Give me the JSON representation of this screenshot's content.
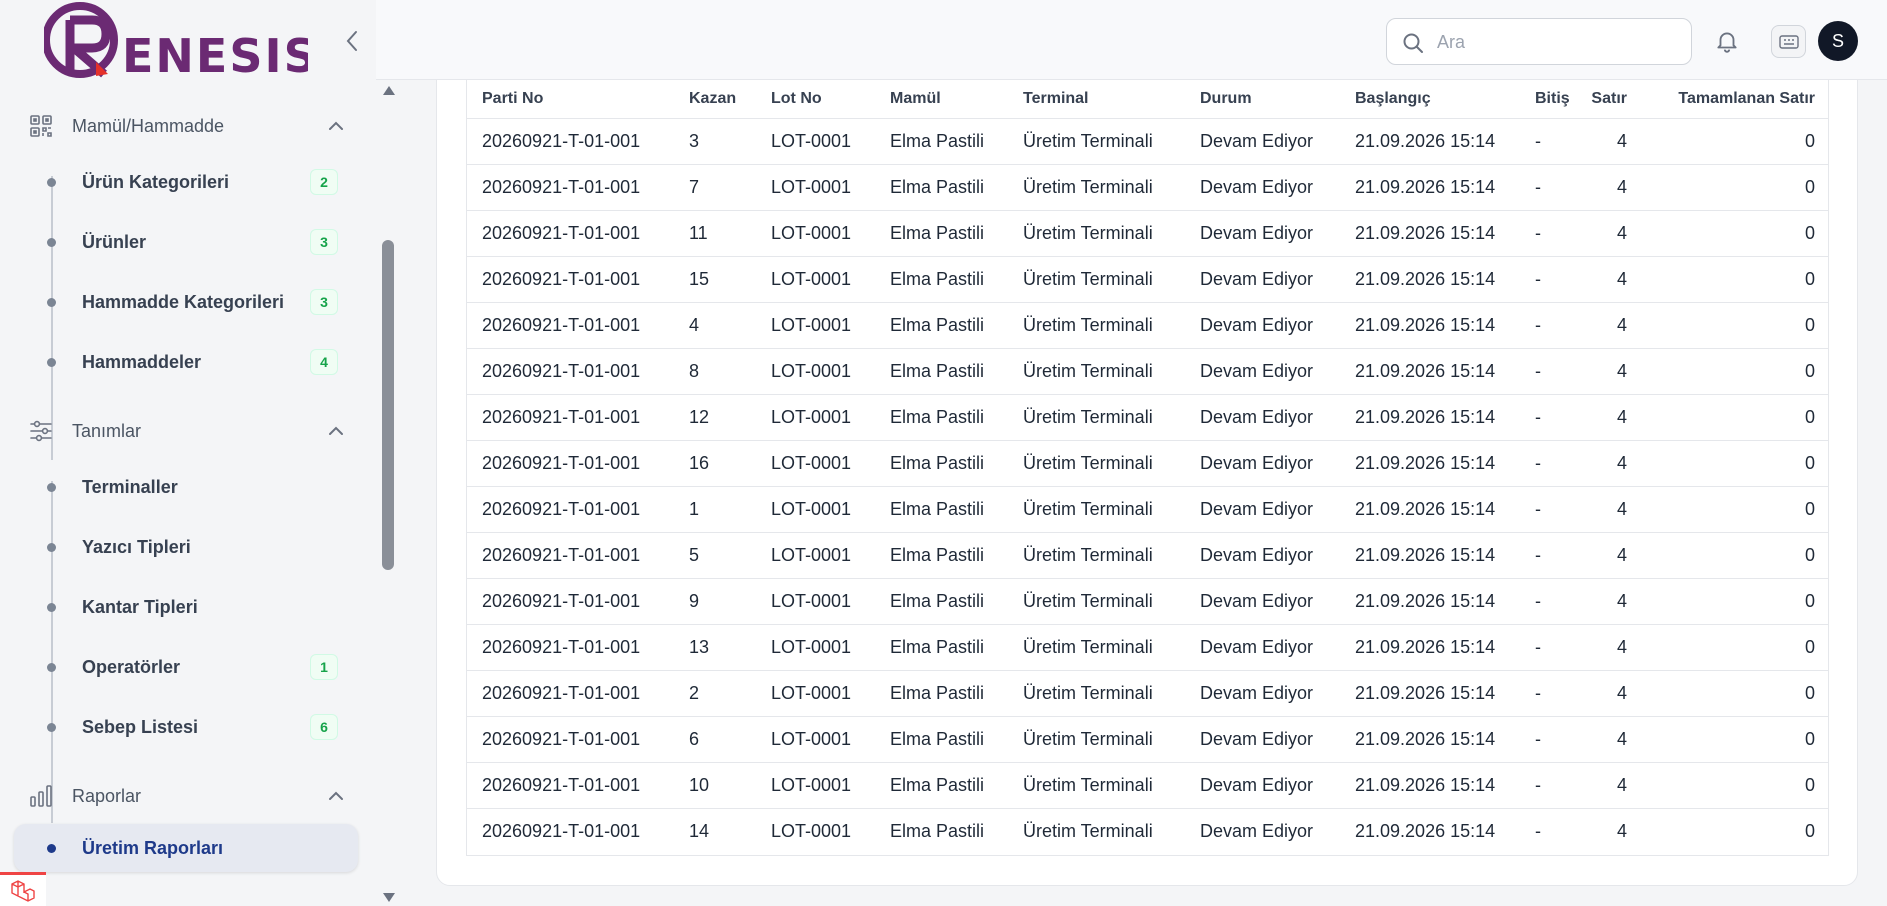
{
  "brand": {
    "logo_text": "RENESIS"
  },
  "search": {
    "placeholder": "Ara"
  },
  "user": {
    "avatar_initial": "S"
  },
  "sidebar": {
    "groups": [
      {
        "label": "Mamül/Hammadde",
        "icon": "qr-grid-icon",
        "items": [
          {
            "label": "Ürün Kategorileri",
            "badge": "2"
          },
          {
            "label": "Ürünler",
            "badge": "3"
          },
          {
            "label": "Hammadde Kategorileri",
            "badge": "3"
          },
          {
            "label": "Hammaddeler",
            "badge": "4"
          }
        ]
      },
      {
        "label": "Tanımlar",
        "icon": "sliders-icon",
        "items": [
          {
            "label": "Terminaller",
            "badge": ""
          },
          {
            "label": "Yazıcı Tipleri",
            "badge": ""
          },
          {
            "label": "Kantar Tipleri",
            "badge": ""
          },
          {
            "label": "Operatörler",
            "badge": "1"
          },
          {
            "label": "Sebep Listesi",
            "badge": "6"
          }
        ]
      },
      {
        "label": "Raporlar",
        "icon": "bar-chart-icon",
        "items": [
          {
            "label": "Üretim Raporları",
            "badge": "",
            "active": true
          }
        ]
      }
    ]
  },
  "table": {
    "columns": [
      "Parti No",
      "Kazan",
      "Lot No",
      "Mamül",
      "Terminal",
      "Durum",
      "Başlangıç",
      "Bitiş",
      "Satır",
      "Tamamlanan Satır"
    ],
    "rows": [
      [
        "20260921-T-01-001",
        "3",
        "LOT-0001",
        "Elma Pastili",
        "Üretim Terminali",
        "Devam Ediyor",
        "21.09.2026 15:14",
        "-",
        "4",
        "0"
      ],
      [
        "20260921-T-01-001",
        "7",
        "LOT-0001",
        "Elma Pastili",
        "Üretim Terminali",
        "Devam Ediyor",
        "21.09.2026 15:14",
        "-",
        "4",
        "0"
      ],
      [
        "20260921-T-01-001",
        "11",
        "LOT-0001",
        "Elma Pastili",
        "Üretim Terminali",
        "Devam Ediyor",
        "21.09.2026 15:14",
        "-",
        "4",
        "0"
      ],
      [
        "20260921-T-01-001",
        "15",
        "LOT-0001",
        "Elma Pastili",
        "Üretim Terminali",
        "Devam Ediyor",
        "21.09.2026 15:14",
        "-",
        "4",
        "0"
      ],
      [
        "20260921-T-01-001",
        "4",
        "LOT-0001",
        "Elma Pastili",
        "Üretim Terminali",
        "Devam Ediyor",
        "21.09.2026 15:14",
        "-",
        "4",
        "0"
      ],
      [
        "20260921-T-01-001",
        "8",
        "LOT-0001",
        "Elma Pastili",
        "Üretim Terminali",
        "Devam Ediyor",
        "21.09.2026 15:14",
        "-",
        "4",
        "0"
      ],
      [
        "20260921-T-01-001",
        "12",
        "LOT-0001",
        "Elma Pastili",
        "Üretim Terminali",
        "Devam Ediyor",
        "21.09.2026 15:14",
        "-",
        "4",
        "0"
      ],
      [
        "20260921-T-01-001",
        "16",
        "LOT-0001",
        "Elma Pastili",
        "Üretim Terminali",
        "Devam Ediyor",
        "21.09.2026 15:14",
        "-",
        "4",
        "0"
      ],
      [
        "20260921-T-01-001",
        "1",
        "LOT-0001",
        "Elma Pastili",
        "Üretim Terminali",
        "Devam Ediyor",
        "21.09.2026 15:14",
        "-",
        "4",
        "0"
      ],
      [
        "20260921-T-01-001",
        "5",
        "LOT-0001",
        "Elma Pastili",
        "Üretim Terminali",
        "Devam Ediyor",
        "21.09.2026 15:14",
        "-",
        "4",
        "0"
      ],
      [
        "20260921-T-01-001",
        "9",
        "LOT-0001",
        "Elma Pastili",
        "Üretim Terminali",
        "Devam Ediyor",
        "21.09.2026 15:14",
        "-",
        "4",
        "0"
      ],
      [
        "20260921-T-01-001",
        "13",
        "LOT-0001",
        "Elma Pastili",
        "Üretim Terminali",
        "Devam Ediyor",
        "21.09.2026 15:14",
        "-",
        "4",
        "0"
      ],
      [
        "20260921-T-01-001",
        "2",
        "LOT-0001",
        "Elma Pastili",
        "Üretim Terminali",
        "Devam Ediyor",
        "21.09.2026 15:14",
        "-",
        "4",
        "0"
      ],
      [
        "20260921-T-01-001",
        "6",
        "LOT-0001",
        "Elma Pastili",
        "Üretim Terminali",
        "Devam Ediyor",
        "21.09.2026 15:14",
        "-",
        "4",
        "0"
      ],
      [
        "20260921-T-01-001",
        "10",
        "LOT-0001",
        "Elma Pastili",
        "Üretim Terminali",
        "Devam Ediyor",
        "21.09.2026 15:14",
        "-",
        "4",
        "0"
      ],
      [
        "20260921-T-01-001",
        "14",
        "LOT-0001",
        "Elma Pastili",
        "Üretim Terminali",
        "Devam Ediyor",
        "21.09.2026 15:14",
        "-",
        "4",
        "0"
      ]
    ]
  },
  "colors": {
    "brand_purple": "#6b2a73",
    "brand_red": "#e5312b",
    "badge_green": "#16a34a",
    "active_blue": "#1e3a8a"
  }
}
